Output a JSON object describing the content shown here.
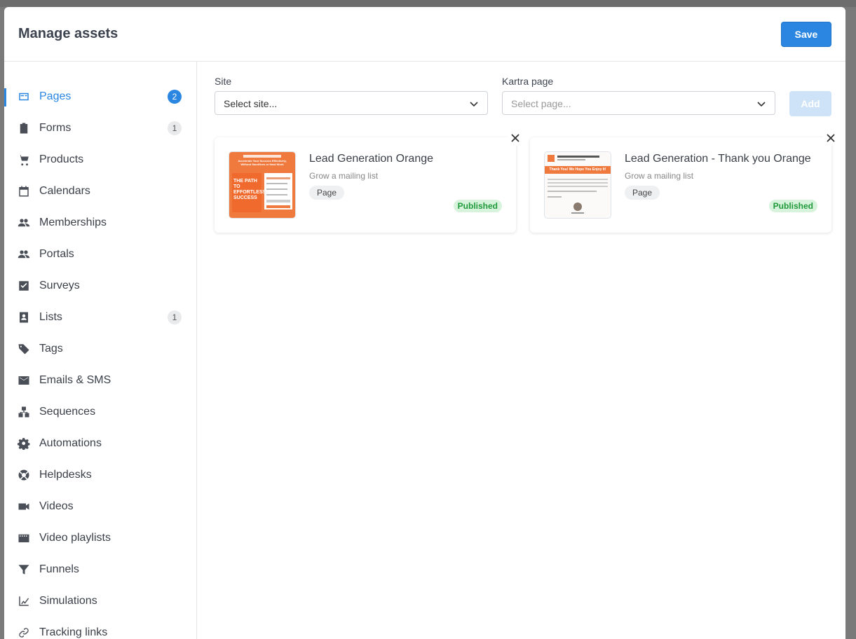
{
  "modal": {
    "title": "Manage assets",
    "save_label": "Save"
  },
  "sidebar": {
    "items": [
      {
        "label": "Pages",
        "icon": "pages-icon",
        "badge": "2",
        "active": true
      },
      {
        "label": "Forms",
        "icon": "clipboard-icon",
        "badge": "1"
      },
      {
        "label": "Products",
        "icon": "cart-icon"
      },
      {
        "label": "Calendars",
        "icon": "calendar-icon"
      },
      {
        "label": "Memberships",
        "icon": "people-icon"
      },
      {
        "label": "Portals",
        "icon": "people-icon"
      },
      {
        "label": "Surveys",
        "icon": "checkbox-icon"
      },
      {
        "label": "Lists",
        "icon": "contact-list-icon",
        "badge": "1"
      },
      {
        "label": "Tags",
        "icon": "tag-icon"
      },
      {
        "label": "Emails & SMS",
        "icon": "mail-icon"
      },
      {
        "label": "Sequences",
        "icon": "sequence-icon"
      },
      {
        "label": "Automations",
        "icon": "gear-icon"
      },
      {
        "label": "Helpdesks",
        "icon": "lifebuoy-icon"
      },
      {
        "label": "Videos",
        "icon": "video-camera-icon"
      },
      {
        "label": "Video playlists",
        "icon": "film-icon"
      },
      {
        "label": "Funnels",
        "icon": "funnel-icon"
      },
      {
        "label": "Simulations",
        "icon": "chart-line-icon"
      },
      {
        "label": "Tracking links",
        "icon": "link-icon"
      }
    ]
  },
  "filters": {
    "site_label": "Site",
    "site_value": "Select site...",
    "page_label": "Kartra page",
    "page_placeholder": "Select page...",
    "add_label": "Add"
  },
  "assets": [
    {
      "title": "Lead Generation Orange",
      "subtitle": "Grow a mailing list",
      "type": "Page",
      "status": "Published"
    },
    {
      "title": "Lead Generation - Thank you Orange",
      "subtitle": "Grow a mailing list",
      "type": "Page",
      "status": "Published"
    }
  ],
  "thumbnails": {
    "first": {
      "headline": "Accelerate Your Success Effectively, Without Sacrifices or Hard Work",
      "hero": "THE PATH TO EFFORTLESS SUCCESS"
    },
    "second": {
      "banner": "Thank You! We Hope You Enjoy It!"
    }
  },
  "colors": {
    "accent": "#2a86e0",
    "thumb_orange": "#f0793e",
    "published_bg": "#d8f3dc",
    "published_text": "#1f9a3a"
  }
}
